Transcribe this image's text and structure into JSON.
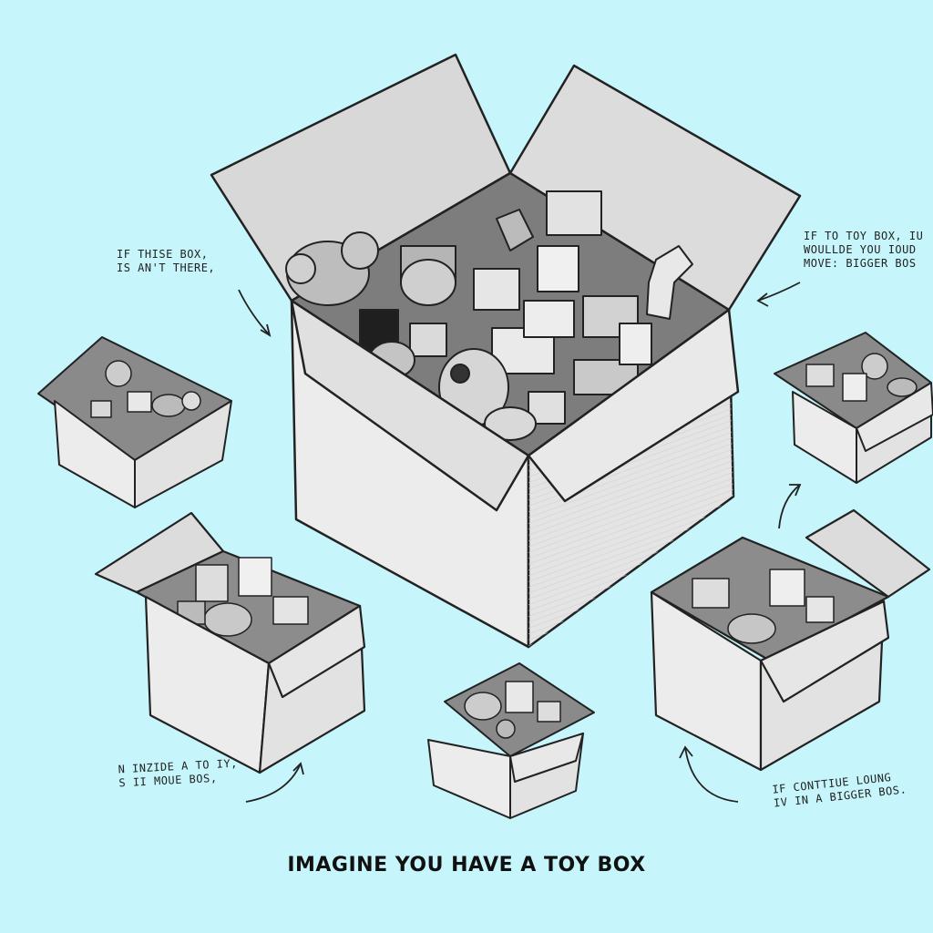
{
  "background_color": "#c6f6fb",
  "caption": "IMAGINE YOU HAVE A TOY BOX",
  "annotations": {
    "top_left": [
      "IF THISE BOX,",
      "IS AN'T THERE,"
    ],
    "top_right": [
      "IF TO TOY BOX, IU",
      "WOULLDE YOU IOUD",
      "MOVE: BIGGER BOS"
    ],
    "bottom_left": [
      "N INZIDE A TO IY,",
      "S II MOUE BOS,"
    ],
    "bottom_right": [
      "IF  CONTTIUE LOUNG",
      "IV IN A BIGGER BOS."
    ]
  }
}
